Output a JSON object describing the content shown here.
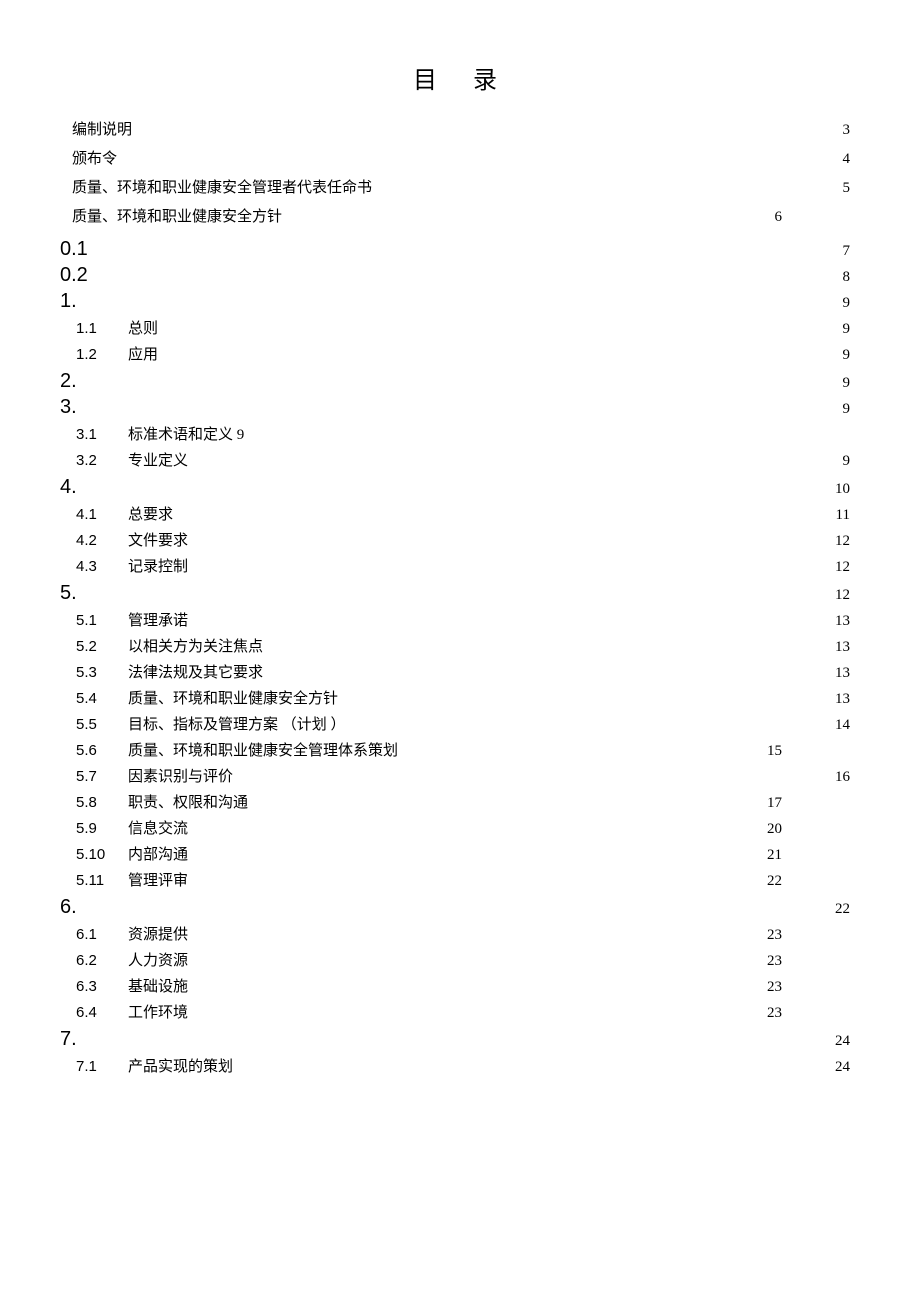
{
  "title": "目录",
  "front": [
    {
      "label": "编制说明",
      "page": "3",
      "alt": false
    },
    {
      "label": "颁布令",
      "page": "4",
      "alt": false
    },
    {
      "label": "质量、环境和职业健康安全管理者代表任命书",
      "page": "5",
      "alt": false
    },
    {
      "label": "质量、环境和职业健康安全方针",
      "page": "6",
      "alt": true
    }
  ],
  "toc": [
    {
      "type": "h1",
      "num": "0.1",
      "label": "",
      "page": "7",
      "alt": false
    },
    {
      "type": "h1",
      "num": "0.2",
      "label": "",
      "page": "8",
      "alt": false
    },
    {
      "type": "h1",
      "num": "1.",
      "label": "",
      "page": "9",
      "alt": false
    },
    {
      "type": "sub",
      "num": "1.1",
      "label": "总则",
      "page": "9",
      "alt": false
    },
    {
      "type": "sub",
      "num": "1.2",
      "label": "应用",
      "page": "9",
      "alt": false
    },
    {
      "type": "h1",
      "num": "2.",
      "label": "",
      "page": "9",
      "alt": false
    },
    {
      "type": "h1",
      "num": "3.",
      "label": "",
      "page": "9",
      "alt": false
    },
    {
      "type": "sub",
      "num": "3.1",
      "label": "标准术语和定义 9",
      "page": "",
      "alt": false
    },
    {
      "type": "sub",
      "num": "3.2",
      "label": "专业定义",
      "page": "9",
      "alt": false
    },
    {
      "type": "h1",
      "num": "4.",
      "label": "",
      "page": "10",
      "alt": false,
      "tight": true
    },
    {
      "type": "sub",
      "num": "4.1",
      "label": "总要求",
      "page": "11",
      "alt": false
    },
    {
      "type": "sub",
      "num": "4.2",
      "label": "文件要求",
      "page": "12",
      "alt": false
    },
    {
      "type": "sub",
      "num": "4.3",
      "label": "记录控制",
      "page": "12",
      "alt": false
    },
    {
      "type": "h1",
      "num": "5.",
      "label": "",
      "page": "12",
      "alt": false,
      "tight": true
    },
    {
      "type": "sub",
      "num": "5.1",
      "label": "管理承诺",
      "page": "13",
      "alt": false
    },
    {
      "type": "sub",
      "num": "5.2",
      "label": "以相关方为关注焦点",
      "page": "13",
      "alt": false
    },
    {
      "type": "sub",
      "num": "5.3",
      "label": "法律法规及其它要求",
      "page": "13",
      "alt": false
    },
    {
      "type": "sub",
      "num": "5.4",
      "label": "质量、环境和职业健康安全方针",
      "page": "13",
      "alt": false
    },
    {
      "type": "sub",
      "num": "5.5",
      "label": "目标、指标及管理方案 （计划 ）",
      "page": "14",
      "alt": false
    },
    {
      "type": "sub",
      "num": "5.6",
      "label": "质量、环境和职业健康安全管理体系策划",
      "page": "15",
      "alt": true
    },
    {
      "type": "sub",
      "num": "5.7",
      "label": "因素识别与评价",
      "page": "16",
      "alt": false
    },
    {
      "type": "sub",
      "num": "5.8",
      "label": "职责、权限和沟通",
      "page": "17",
      "alt": true
    },
    {
      "type": "sub",
      "num": "5.9",
      "label": "信息交流",
      "page": "20",
      "alt": true
    },
    {
      "type": "sub",
      "num": "5.10",
      "label": "内部沟通",
      "page": "21",
      "alt": true
    },
    {
      "type": "sub",
      "num": "5.11",
      "label": "管理评审",
      "page": "22",
      "alt": true
    },
    {
      "type": "h1",
      "num": "6.",
      "label": "",
      "page": "22",
      "alt": false,
      "tight": true
    },
    {
      "type": "sub",
      "num": "6.1",
      "label": "资源提供",
      "page": "23",
      "alt": true
    },
    {
      "type": "sub",
      "num": "6.2",
      "label": "人力资源",
      "page": "23",
      "alt": true
    },
    {
      "type": "sub",
      "num": "6.3",
      "label": "基础设施",
      "page": "23",
      "alt": true
    },
    {
      "type": "sub",
      "num": "6.4",
      "label": "工作环境",
      "page": "23",
      "alt": true
    },
    {
      "type": "h1",
      "num": "7.",
      "label": "",
      "page": "24",
      "alt": false,
      "tight": true
    },
    {
      "type": "sub",
      "num": "7.1",
      "label": "产品实现的策划",
      "page": "24",
      "alt": false
    }
  ]
}
